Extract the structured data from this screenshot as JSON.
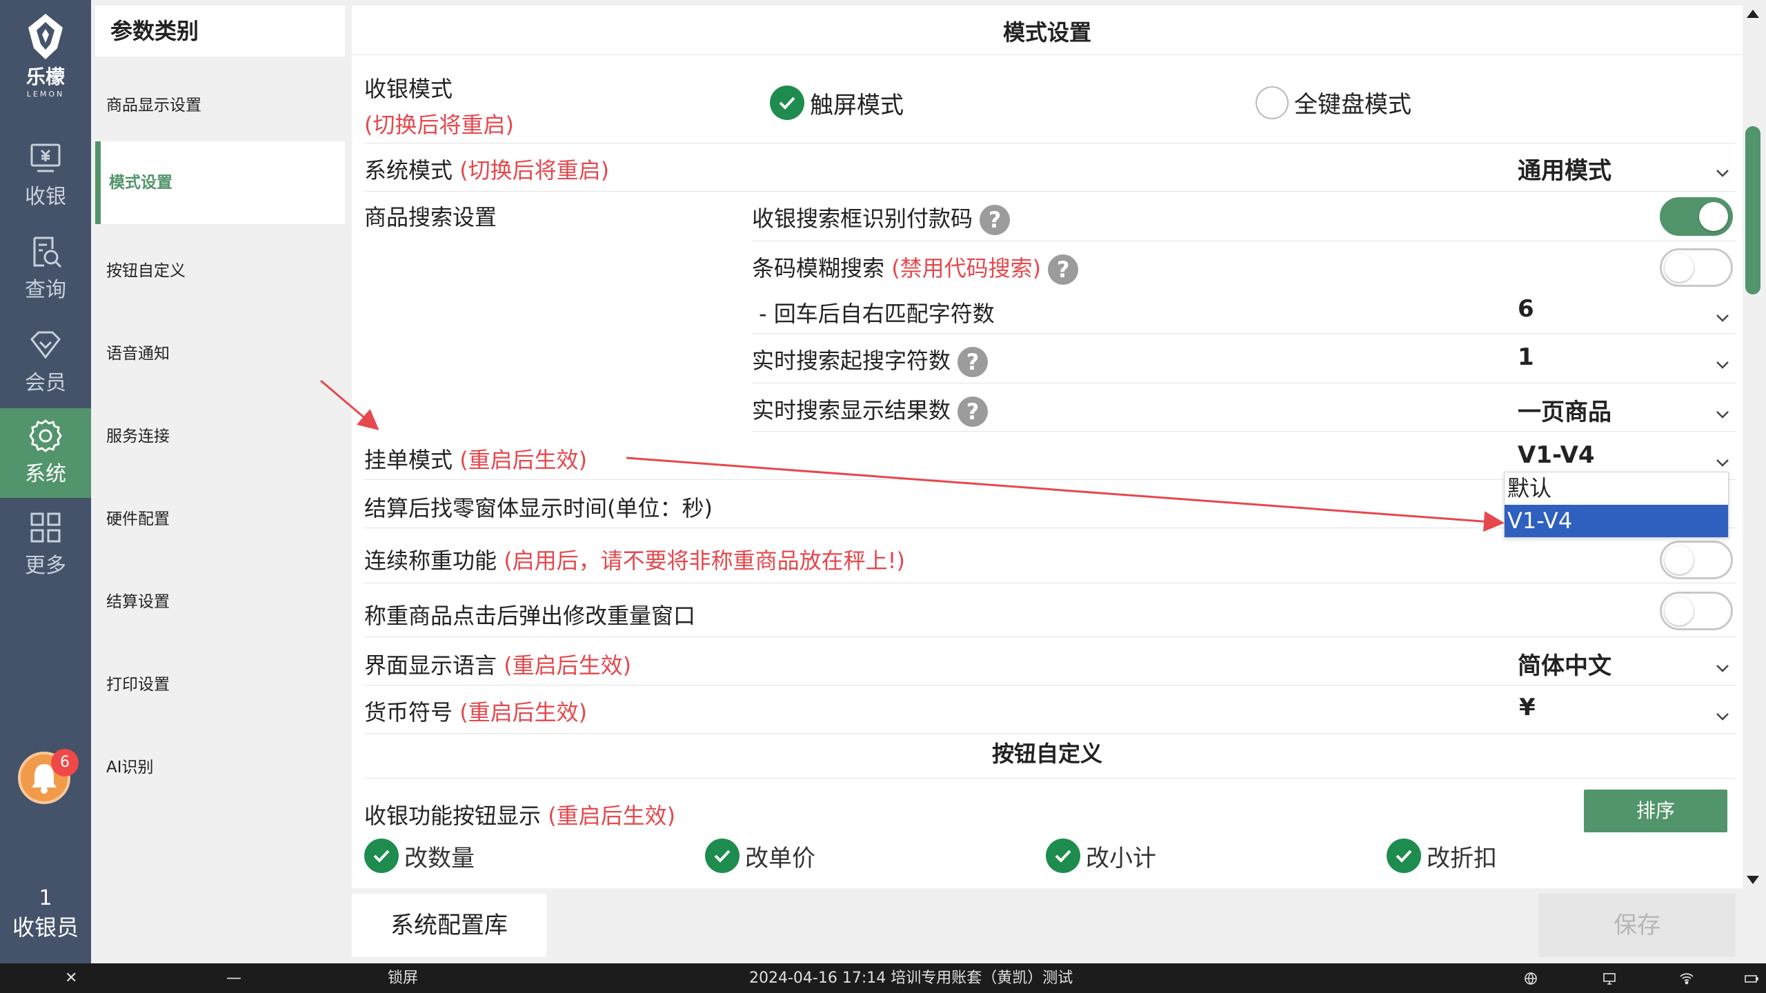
{
  "brand": {
    "name": "乐檬",
    "sub": "LEMON"
  },
  "nav": [
    {
      "label": "收银",
      "icon": "cashier-icon"
    },
    {
      "label": "查询",
      "icon": "query-icon"
    },
    {
      "label": "会员",
      "icon": "member-icon"
    },
    {
      "label": "系统",
      "icon": "gear-icon",
      "active": true
    },
    {
      "label": "更多",
      "icon": "grid-icon"
    }
  ],
  "notifications": {
    "count": "6"
  },
  "user": {
    "id": "1",
    "role": "收银员"
  },
  "categories": {
    "header": "参数类别",
    "items": [
      "商品显示设置",
      "模式设置",
      "按钮自定义",
      "语音通知",
      "服务连接",
      "硬件配置",
      "结算设置",
      "打印设置",
      "AI识别"
    ],
    "active_index": 1
  },
  "main": {
    "title": "模式设置",
    "cashier_mode": {
      "label": "收银模式",
      "note": "(切换后将重启)",
      "opt1": "触屏模式",
      "opt2": "全键盘模式"
    },
    "system_mode": {
      "label": "系统模式",
      "note": "(切换后将重启)",
      "value": "通用模式"
    },
    "search": {
      "label": "商品搜索设置",
      "r1": "收银搜索框识别付款码",
      "r2": "条码模糊搜索",
      "r2_note": "(禁用代码搜索)",
      "r3": "- 回车后自右匹配字符数",
      "r3_value": "6",
      "r4": "实时搜索起搜字符数",
      "r4_value": "1",
      "r5": "实时搜索显示结果数",
      "r5_value": "一页商品",
      "help": "?"
    },
    "hold_mode": {
      "label": "挂单模式",
      "note": "(重启后生效)",
      "value": "V1-V4"
    },
    "change_window": {
      "label": "结算后找零窗体显示时间(单位：秒)"
    },
    "weighing": {
      "label": "连续称重功能",
      "note": "(启用后，请不要将非称重商品放在秤上!)"
    },
    "weigh_popup": {
      "label": "称重商品点击后弹出修改重量窗口"
    },
    "language": {
      "label": "界面显示语言",
      "note": "(重启后生效)",
      "value": "简体中文"
    },
    "currency": {
      "label": "货币符号",
      "note": "(重启后生效)",
      "value": "¥"
    },
    "button_section": {
      "title": "按钮自定义",
      "label": "收银功能按钮显示",
      "note": "(重启后生效)",
      "sort": "排序",
      "items": [
        "改数量",
        "改单价",
        "改小计",
        "改折扣"
      ]
    },
    "dropdown": {
      "options": [
        "默认",
        "V1-V4"
      ],
      "selected": 1
    }
  },
  "footer": {
    "lib": "系统配置库",
    "save": "保存"
  },
  "taskbar": {
    "close": "✕",
    "minimize": "—",
    "lock": "锁屏",
    "status": "2024-04-16 17:14 培训专用账套（黄凯）测试"
  },
  "colors": {
    "accent": "#52946b",
    "nav_bg": "#44536a",
    "warn": "#e5484d",
    "select": "#2f5fbf"
  }
}
